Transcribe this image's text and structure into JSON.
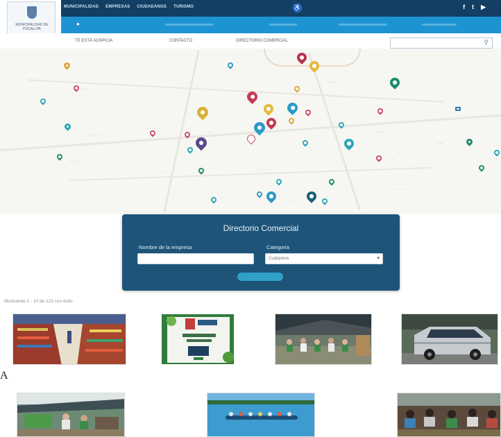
{
  "header": {
    "logo_text": "MUNICIPALIDAD DE PUCALLPA",
    "top_nav": [
      "MUNICIPALIDAD",
      "EMPRESAS",
      "CIUDADANOS",
      "TURISMO"
    ],
    "social": [
      "f",
      "t",
      "▶"
    ]
  },
  "sub_nav": {
    "items": [
      "TE ESTÁ AUSPICIA",
      "CONTACTO",
      "DIRECTORIO COMERCIAL"
    ]
  },
  "directory": {
    "title": "Directorio Comercial",
    "company_label": "Nombre de la empresa",
    "category_label": "Categoría",
    "category_value": "Cualquiera"
  },
  "results": {
    "count_text": "Mostrando 1 - 10 de 123 con éxito"
  },
  "colors": {
    "navy": "#123f63",
    "blue": "#1e93d2",
    "card": "#1e5478",
    "button": "#2fa1c9"
  },
  "marker_label": "A"
}
